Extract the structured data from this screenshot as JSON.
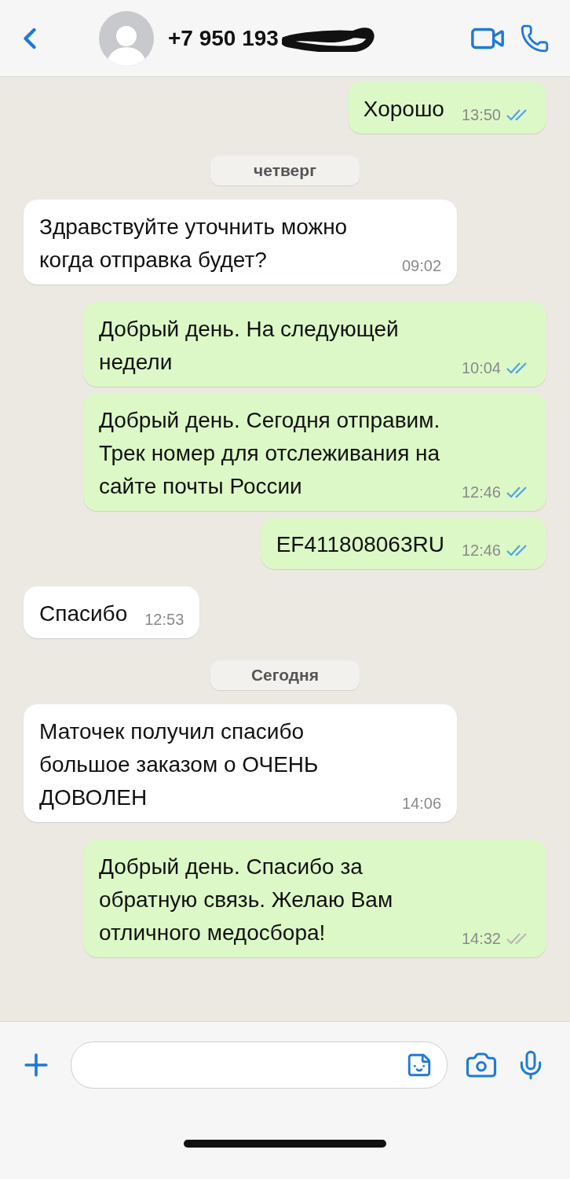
{
  "header": {
    "contact": "+7 950 193"
  },
  "messages": [
    {
      "kind": "outgoing",
      "text": "Хорошо",
      "time": "13:50",
      "read": true
    },
    {
      "kind": "date",
      "text": "четверг"
    },
    {
      "kind": "incoming",
      "text": "Здравствуйте уточнить можно когда отправка будет?",
      "time": "09:02"
    },
    {
      "kind": "outgoing",
      "text": "Добрый день. На следующей недели",
      "time": "10:04",
      "read": true
    },
    {
      "kind": "outgoing",
      "text": "Добрый день. Сегодня отправим. Трек номер для отслеживания на сайте почты России",
      "time": "12:46",
      "read": true
    },
    {
      "kind": "outgoing",
      "text": "EF411808063RU",
      "time": "12:46",
      "read": true
    },
    {
      "kind": "incoming",
      "text": "Спасибо",
      "time": "12:53"
    },
    {
      "kind": "date",
      "text": "Сегодня"
    },
    {
      "kind": "incoming",
      "text": "Маточек получил спасибо большое заказом о ОЧЕНЬ ДОВОЛЕН",
      "time": "14:06"
    },
    {
      "kind": "outgoing",
      "text": "Добрый день. Спасибо за обратную связь. Желаю Вам отличного медосбора!",
      "time": "14:32",
      "read": false
    }
  ]
}
